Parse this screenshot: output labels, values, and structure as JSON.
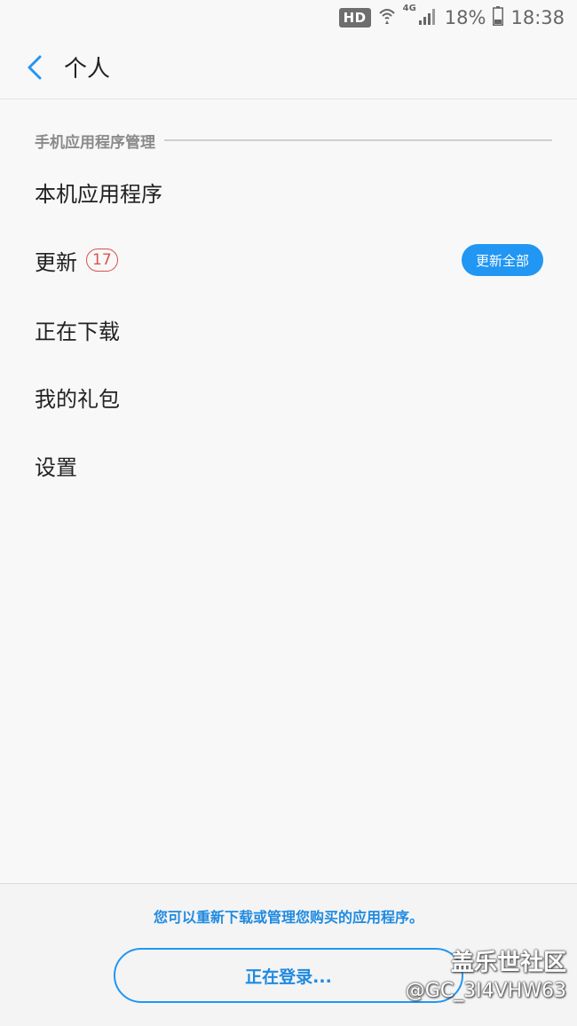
{
  "status_bar": {
    "hd": "HD",
    "network": "4G",
    "battery": "18%",
    "time": "18:38"
  },
  "header": {
    "title": "个人"
  },
  "section": {
    "title": "手机应用程序管理"
  },
  "menu": {
    "items": [
      {
        "label": "本机应用程序"
      },
      {
        "label": "更新",
        "badge": "17",
        "action": "更新全部"
      },
      {
        "label": "正在下载"
      },
      {
        "label": "我的礼包"
      },
      {
        "label": "设置"
      }
    ]
  },
  "footer": {
    "message": "您可以重新下载或管理您购买的应用程序。",
    "login_label": "正在登录..."
  },
  "watermark": {
    "brand": "盖乐世社区",
    "user": "@GC_3I4VHW63"
  },
  "colors": {
    "accent": "#2196f3",
    "badge": "#d9534f"
  }
}
